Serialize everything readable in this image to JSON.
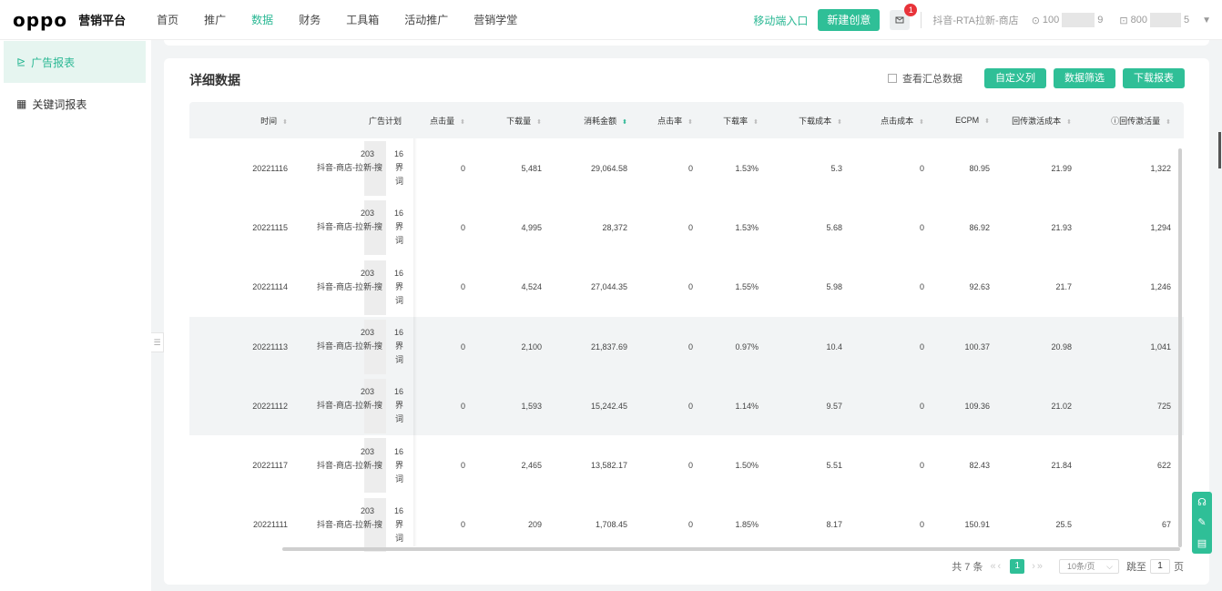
{
  "header": {
    "logo": "oppo",
    "platform": "营销平台",
    "nav": [
      {
        "label": "首页",
        "active": false
      },
      {
        "label": "推广",
        "active": false
      },
      {
        "label": "数据",
        "active": true
      },
      {
        "label": "财务",
        "active": false
      },
      {
        "label": "工具箱",
        "active": false
      },
      {
        "label": "活动推广",
        "active": false
      },
      {
        "label": "营销学堂",
        "active": false
      }
    ],
    "mobile_entry": "移动端入口",
    "new_creative": "新建创意",
    "message_badge": "1",
    "account_name": "抖音-RTA拉新-商店",
    "account_id_prefix": "100",
    "account_id_suffix": "9",
    "account_id2_prefix": "800",
    "account_id2_suffix": "5"
  },
  "sidebar": {
    "items": [
      {
        "label": "广告报表",
        "icon": "chart-line-icon",
        "active": true
      },
      {
        "label": "关键词报表",
        "icon": "grid-icon",
        "active": false
      }
    ]
  },
  "main": {
    "title": "详细数据",
    "show_summary": "查看汇总数据",
    "buttons": {
      "custom_columns": "自定义列",
      "filter": "数据筛选",
      "download": "下载报表"
    },
    "columns": [
      "时间",
      "广告计划",
      "点击量",
      "下载量",
      "消耗金额",
      "点击率",
      "下载率",
      "下载成本",
      "点击成本",
      "ECPM",
      "回传激活成本",
      "回传激活量"
    ],
    "rows": [
      {
        "date": "20221116",
        "plan1": "203",
        "plan1b": "16",
        "plan2": "抖音-商店-拉新-搜",
        "plan2b": "界",
        "plan3": "词",
        "clicks": "0",
        "downloads": "5,481",
        "spend": "29,064.58",
        "ctr": "0",
        "dl_rate": "1.53%",
        "dl_cost": "5.3",
        "click_cost": "0",
        "ecpm": "80.95",
        "act_cost": "21.99",
        "act_count": "1,322"
      },
      {
        "date": "20221115",
        "plan1": "203",
        "plan1b": "16",
        "plan2": "抖音-商店-拉新-搜",
        "plan2b": "界",
        "plan3": "词",
        "clicks": "0",
        "downloads": "4,995",
        "spend": "28,372",
        "ctr": "0",
        "dl_rate": "1.53%",
        "dl_cost": "5.68",
        "click_cost": "0",
        "ecpm": "86.92",
        "act_cost": "21.93",
        "act_count": "1,294"
      },
      {
        "date": "20221114",
        "plan1": "203",
        "plan1b": "16",
        "plan2": "抖音-商店-拉新-搜",
        "plan2b": "界",
        "plan3": "词",
        "clicks": "0",
        "downloads": "4,524",
        "spend": "27,044.35",
        "ctr": "0",
        "dl_rate": "1.55%",
        "dl_cost": "5.98",
        "click_cost": "0",
        "ecpm": "92.63",
        "act_cost": "21.7",
        "act_count": "1,246"
      },
      {
        "date": "20221113",
        "plan1": "203",
        "plan1b": "16",
        "plan2": "抖音-商店-拉新-搜",
        "plan2b": "界",
        "plan3": "词",
        "clicks": "0",
        "downloads": "2,100",
        "spend": "21,837.69",
        "ctr": "0",
        "dl_rate": "0.97%",
        "dl_cost": "10.4",
        "click_cost": "0",
        "ecpm": "100.37",
        "act_cost": "20.98",
        "act_count": "1,041"
      },
      {
        "date": "20221112",
        "plan1": "203",
        "plan1b": "16",
        "plan2": "抖音-商店-拉新-搜",
        "plan2b": "界",
        "plan3": "词",
        "clicks": "0",
        "downloads": "1,593",
        "spend": "15,242.45",
        "ctr": "0",
        "dl_rate": "1.14%",
        "dl_cost": "9.57",
        "click_cost": "0",
        "ecpm": "109.36",
        "act_cost": "21.02",
        "act_count": "725"
      },
      {
        "date": "20221117",
        "plan1": "203",
        "plan1b": "16",
        "plan2": "抖音-商店-拉新-搜",
        "plan2b": "界",
        "plan3": "词",
        "clicks": "0",
        "downloads": "2,465",
        "spend": "13,582.17",
        "ctr": "0",
        "dl_rate": "1.50%",
        "dl_cost": "5.51",
        "click_cost": "0",
        "ecpm": "82.43",
        "act_cost": "21.84",
        "act_count": "622"
      },
      {
        "date": "20221111",
        "plan1": "203",
        "plan1b": "16",
        "plan2": "抖音-商店-拉新-搜",
        "plan2b": "界",
        "plan3": "词",
        "clicks": "0",
        "downloads": "209",
        "spend": "1,708.45",
        "ctr": "0",
        "dl_rate": "1.85%",
        "dl_cost": "8.17",
        "click_cost": "0",
        "ecpm": "150.91",
        "act_cost": "25.5",
        "act_count": "67"
      }
    ]
  },
  "pagination": {
    "total": "共 7 条",
    "current_page": "1",
    "page_size": "10条/页",
    "jump_label": "跳至",
    "jump_value": "1",
    "page_unit": "页"
  },
  "colors": {
    "accent": "#2fbf97",
    "badge": "#e8333a",
    "active_bg": "#e6f5f0"
  }
}
